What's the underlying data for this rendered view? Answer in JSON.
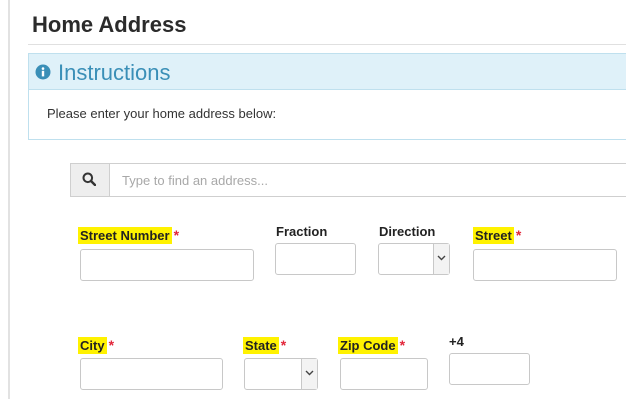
{
  "page": {
    "title": "Home Address"
  },
  "instructions": {
    "heading": "Instructions",
    "body": "Please enter your home address below:"
  },
  "search": {
    "placeholder": "Type to find an address...",
    "value": ""
  },
  "fields": {
    "street_number": {
      "label": "Street Number",
      "required_mark": "*",
      "value": ""
    },
    "fraction": {
      "label": "Fraction",
      "value": ""
    },
    "direction": {
      "label": "Direction",
      "selected": ""
    },
    "street": {
      "label": "Street",
      "required_mark": "*",
      "value": ""
    },
    "city": {
      "label": "City",
      "required_mark": "*",
      "value": ""
    },
    "state": {
      "label": "State",
      "required_mark": "*",
      "selected": ""
    },
    "zip_code": {
      "label": "Zip Code",
      "required_mark": "*",
      "value": ""
    },
    "plus_four": {
      "label": "+4",
      "value": ""
    }
  },
  "colors": {
    "highlight": "#fff200",
    "required": "#e2263a",
    "instructions_accent": "#3a8fb7",
    "instructions_bg": "#dff1f9"
  },
  "icons": {
    "instructions": "info-circle-icon",
    "search": "search-icon",
    "select": "chevron-down-icon"
  }
}
